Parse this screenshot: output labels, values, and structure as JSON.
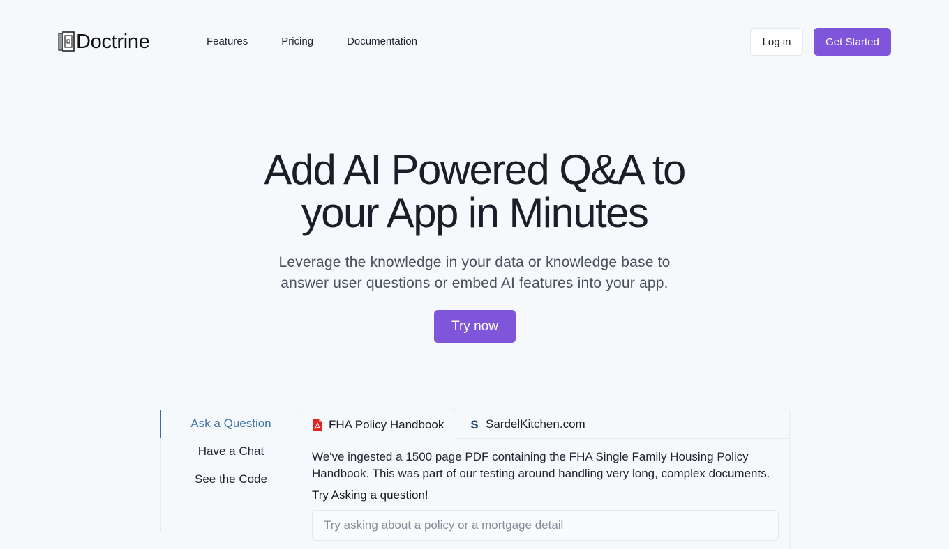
{
  "brand": {
    "name": "Doctrine",
    "logo_icon": "book-stack-icon"
  },
  "nav": {
    "links": [
      {
        "label": "Features"
      },
      {
        "label": "Pricing"
      },
      {
        "label": "Documentation"
      }
    ],
    "login_label": "Log in",
    "get_started_label": "Get Started"
  },
  "hero": {
    "title_line1": "Add AI Powered Q&A to",
    "title_line2": "your App in Minutes",
    "subtitle_line1": "Leverage the knowledge in your data or knowledge base to",
    "subtitle_line2": "answer user questions or embed AI features into your app.",
    "cta_label": "Try now"
  },
  "demo": {
    "side_nav": [
      {
        "label": "Ask a Question",
        "active": true
      },
      {
        "label": "Have a Chat",
        "active": false
      },
      {
        "label": "See the Code",
        "active": false
      }
    ],
    "tabs": [
      {
        "label": "FHA Policy Handbook",
        "icon": "pdf-icon",
        "active": true
      },
      {
        "label": "SardelKitchen.com",
        "icon": "sardel-s-icon",
        "active": false
      }
    ],
    "description_line1": "We've ingested a 1500 page PDF containing the FHA Single Family Housing Policy",
    "description_line2": "Handbook. This was part of our testing around handling very long, complex documents.",
    "prompt_label": "Try Asking a question!",
    "input": {
      "value": "",
      "placeholder": "Try asking about a policy or a mortgage detail"
    }
  },
  "colors": {
    "accent": "#7f56d9",
    "active_link": "#3f72aa",
    "background": "#f6f9fc",
    "pdf_red": "#e0231f",
    "sardel_blue": "#234a7a"
  }
}
